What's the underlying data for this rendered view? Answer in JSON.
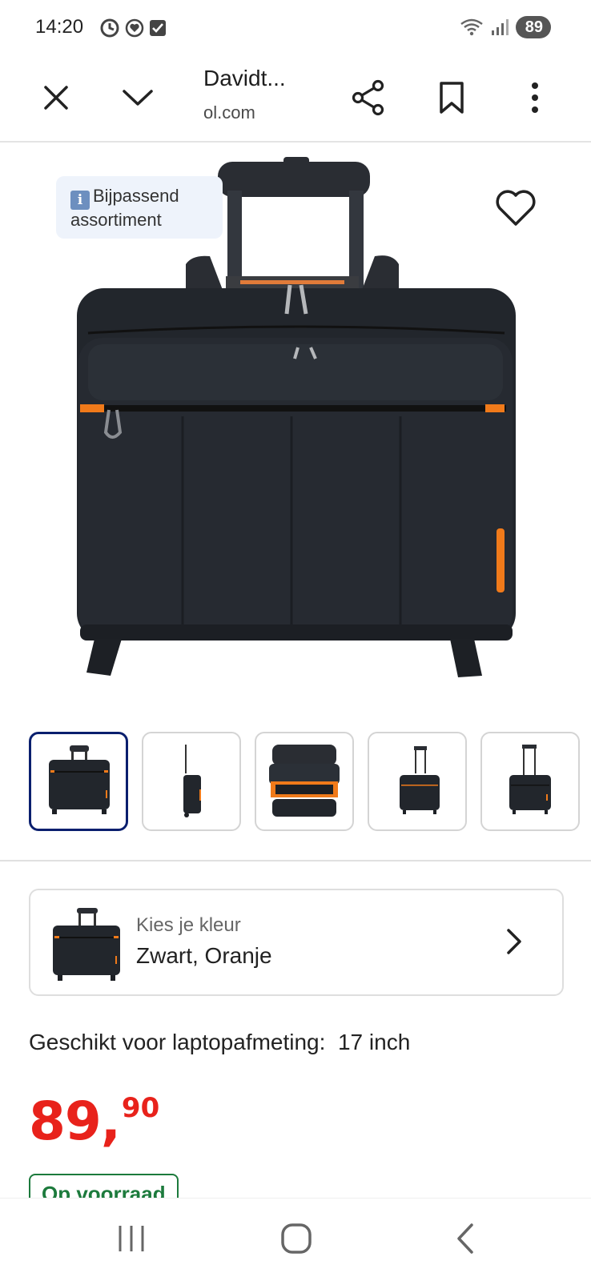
{
  "status": {
    "time": "14:20",
    "battery": "89"
  },
  "browser": {
    "page_title": "Davidt...",
    "domain": "ol.com",
    "icons": [
      "close-icon",
      "chevron-down-icon",
      "share-icon",
      "bookmark-icon",
      "more-vert-icon"
    ]
  },
  "product": {
    "badge": "Bijpassend assortiment",
    "thumbnails": [
      "front",
      "side",
      "open-compartments",
      "front-small",
      "front-extended"
    ],
    "selected_thumbnail": 0,
    "color_selector": {
      "label": "Kies je kleur",
      "value": "Zwart, Oranje"
    },
    "spec_label": "Geschikt voor laptopafmeting:",
    "spec_value": "17 inch",
    "price_main": "89,",
    "price_cents": "90",
    "stock_label": "Op voorraad"
  },
  "colors": {
    "price_red": "#e8221b",
    "stock_green": "#1c7a3c",
    "selected_thumb_border": "#0a1f6e",
    "bag_black": "#22262c",
    "bag_orange": "#f07a1a"
  },
  "navbar": {
    "icons": [
      "recent-apps-icon",
      "home-icon",
      "back-icon"
    ]
  }
}
